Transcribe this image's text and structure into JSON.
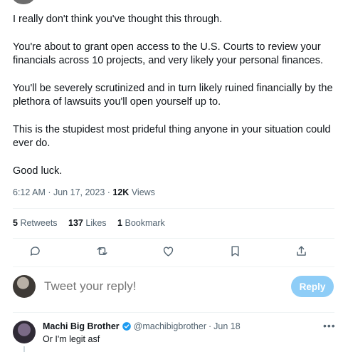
{
  "tweet": {
    "paragraphs": [
      "I really don't think you've thought this through.",
      "You're about to grant open access to the U.S. Courts to review your financials across 10 projects, and very likely your personal finances.",
      "You'll be severely scrutinized and in turn likely ruined financially by the plethora of lawsuits you'll open yourself up to.",
      "This is the stupidest most prideful thing anyone in your situation could ever do.",
      "Good luck."
    ],
    "time": "6:12 AM",
    "date": "Jun 17, 2023",
    "views_count": "12K",
    "views_label": "Views"
  },
  "stats": {
    "retweets_count": "5",
    "retweets_label": "Retweets",
    "likes_count": "137",
    "likes_label": "Likes",
    "bookmarks_count": "1",
    "bookmarks_label": "Bookmark"
  },
  "actions": [
    "reply-icon",
    "retweet-icon",
    "like-icon",
    "bookmark-icon",
    "share-icon"
  ],
  "composer": {
    "placeholder": "Tweet your reply!",
    "button_label": "Reply",
    "button_color": "#8ecdf7"
  },
  "reply": {
    "name": "Machi Big Brother",
    "handle": "@machibigbrother",
    "date": "Jun 18",
    "text": "Or I'm legit asf",
    "more_icon": "more-icon",
    "verified_color": "#1d9bf0"
  }
}
